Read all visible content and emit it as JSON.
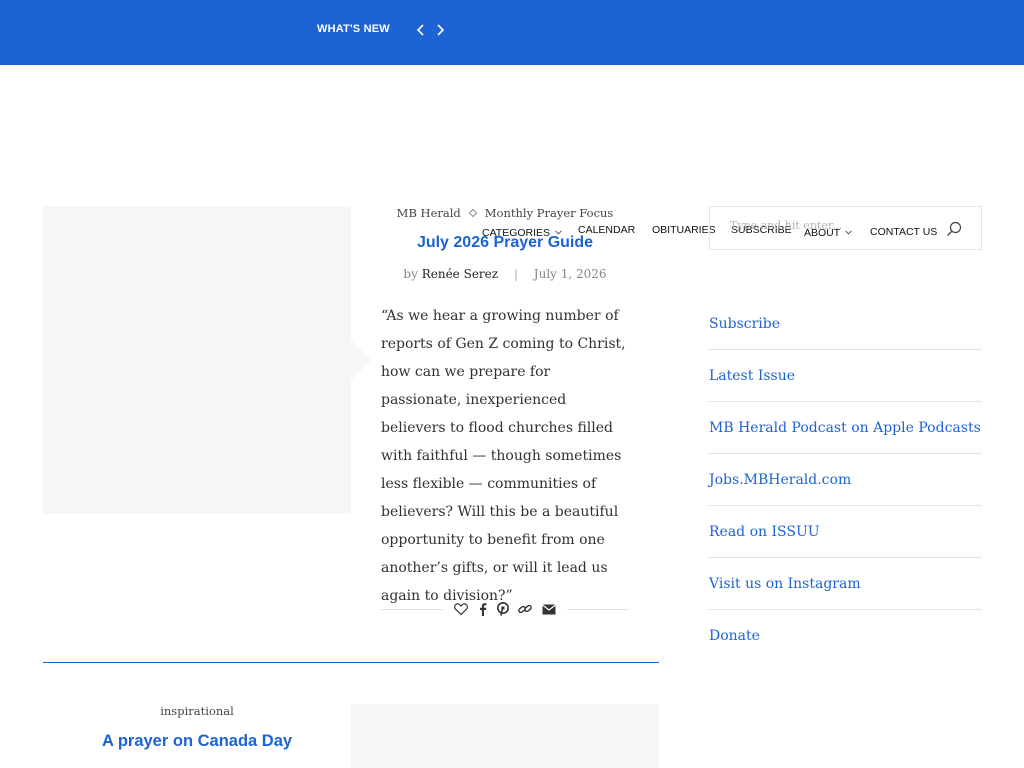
{
  "topbar": {
    "label": "WHAT'S NEW",
    "prev_icon": "chevron-left-icon",
    "next_icon": "chevron-right-icon"
  },
  "nav": {
    "items": [
      {
        "label": "CATEGORIES",
        "has_dropdown": true
      },
      {
        "label": "CALENDAR",
        "has_dropdown": false
      },
      {
        "label": "OBITUARIES",
        "has_dropdown": false
      },
      {
        "label": "SUBSCRIBE",
        "has_dropdown": false
      },
      {
        "label": "ABOUT",
        "has_dropdown": true
      },
      {
        "label": "CONTACT US",
        "has_dropdown": false
      }
    ]
  },
  "posts": [
    {
      "categories": [
        "MB Herald",
        "Monthly Prayer Focus"
      ],
      "title": "July 2026 Prayer Guide",
      "by": "by",
      "author": "Renée Serez",
      "date": "July 1, 2026",
      "excerpt": "“As we hear a growing number of reports of Gen Z coming to Christ, how can we prepare for passionate, inexperienced believers to flood churches filled with faithful — though sometimes less flexible — communities of believers? Will this be a beautiful opportunity to benefit from one another’s gifts, or will it lead us again to division?”",
      "share_icons": [
        "heart-icon",
        "facebook-icon",
        "pinterest-icon",
        "link-icon",
        "email-icon"
      ]
    },
    {
      "categories": [
        "inspirational"
      ],
      "title": "A prayer on Canada Day"
    }
  ],
  "sidebar": {
    "search_placeholder": "Type and hit enter...",
    "links": [
      "Subscribe",
      "Latest Issue",
      "MB Herald Podcast on Apple Podcasts",
      "Jobs.MBHerald.com",
      "Read on ISSUU",
      "Visit us on Instagram",
      "Donate"
    ]
  },
  "colors": {
    "brand_blue": "#1d63d4",
    "thumb_bg": "#f6f6f6",
    "text": "#313131"
  }
}
